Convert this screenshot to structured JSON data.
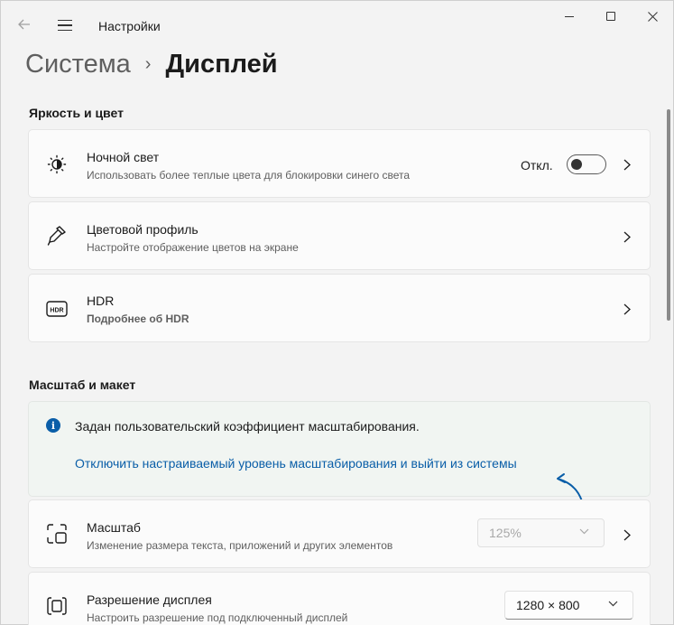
{
  "window": {
    "app_title": "Настройки"
  },
  "breadcrumb": {
    "parent": "Система",
    "separator": "›",
    "current": "Дисплей"
  },
  "sections": {
    "brightness_title": "Яркость и цвет",
    "scale_title": "Масштаб и макет"
  },
  "night_light": {
    "title": "Ночной свет",
    "subtitle": "Использовать более теплые цвета для блокировки синего света",
    "state_label": "Откл.",
    "enabled": false
  },
  "color_profile": {
    "title": "Цветовой профиль",
    "subtitle": "Настройте отображение цветов на экране"
  },
  "hdr": {
    "title": "HDR",
    "link": "Подробнее об HDR",
    "icon_text": "HDR"
  },
  "info": {
    "message": "Задан пользовательский коэффициент масштабирования.",
    "link": "Отключить настраиваемый уровень масштабирования и выйти из системы"
  },
  "scale": {
    "title": "Масштаб",
    "subtitle": "Изменение размера текста, приложений и других элементов",
    "value": "125%",
    "disabled": true
  },
  "resolution": {
    "title": "Разрешение дисплея",
    "subtitle": "Настроить разрешение под подключенный дисплей",
    "value": "1280 × 800"
  },
  "colors": {
    "accent": "#0a5ea8",
    "background": "#f3f3f3",
    "card": "#fbfbfb"
  }
}
